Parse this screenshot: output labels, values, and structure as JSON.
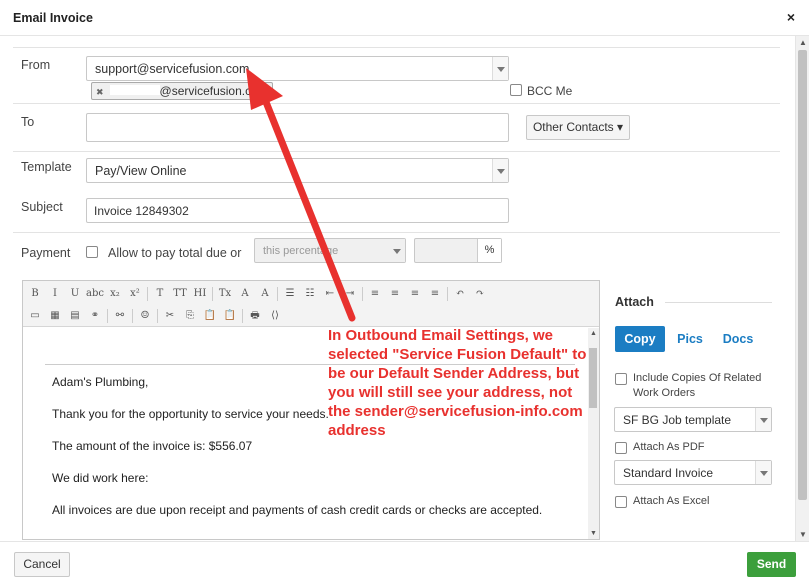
{
  "dialog": {
    "title": "Email Invoice",
    "close_glyph": "×"
  },
  "form": {
    "from_label": "From",
    "from_value": "support@servicefusion.com",
    "bcc_label": "BCC Me",
    "to_label": "To",
    "to_value": "@servicefusion.com",
    "to_remove_glyph": "✖",
    "other_contacts_label": "Other Contacts ▾",
    "template_label": "Template",
    "template_value": "Pay/View Online",
    "subject_label": "Subject",
    "subject_value": "Invoice 12849302",
    "payment_label": "Payment",
    "allow_pay_label": "Allow to pay total due or",
    "percentage_placeholder": "this percentage",
    "percent_symbol": "%"
  },
  "editor": {
    "toolbar_row1": [
      "B",
      "I",
      "U",
      "abc",
      "x₂",
      "x²",
      "T",
      "TT",
      "HI",
      "Tx",
      "A",
      "A",
      "☰",
      "☷",
      "⇤",
      "⇥",
      "≡",
      "≡",
      "≡",
      "≡",
      "↶",
      "↷"
    ],
    "toolbar_row2": [
      "▭",
      "▦",
      "▤",
      "⚭",
      "⚯",
      "☺",
      "✂",
      "⎘",
      "📋",
      "📋",
      "🖶",
      "⟨⟩"
    ],
    "lines": [
      "Adam's Plumbing,",
      "Thank you for the opportunity to service your needs.",
      "The amount of the invoice is: $556.07",
      "We did work here:",
      "All invoices are due upon receipt and payments of cash credit cards or checks are accepted."
    ]
  },
  "attach": {
    "title": "Attach",
    "tabs": [
      "Copy",
      "Pics",
      "Docs"
    ],
    "include_copies_label": "Include Copies Of Related Work Orders",
    "job_template_value": "SF BG Job template",
    "attach_pdf_label": "Attach As PDF",
    "invoice_template_value": "Standard Invoice",
    "attach_excel_label": "Attach As Excel"
  },
  "annotation": {
    "text": "In Outbound Email Settings, we selected \"Service Fusion Default\" to be our Default Sender Address, but you will still see your address, not the sender@servicefusion-info.com address",
    "color": "#e8312e"
  },
  "footer": {
    "cancel_label": "Cancel",
    "send_label": "Send"
  },
  "colors": {
    "accent": "#1b7dc3",
    "send": "#3c9f3c"
  }
}
